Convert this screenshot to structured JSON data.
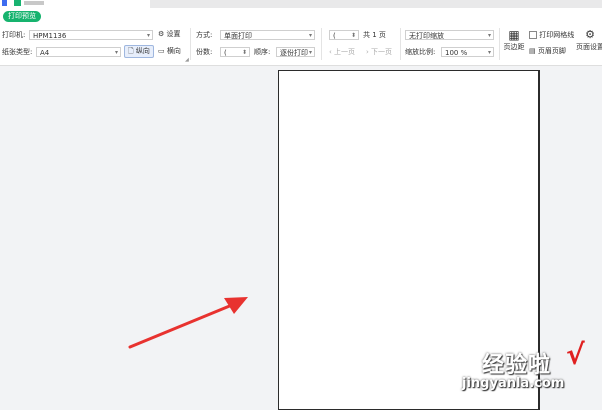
{
  "toolbar": {
    "preview_tab": "打印预览",
    "printer_label": "打印机:",
    "printer_value": "HPM1136",
    "settings_label": "设置",
    "paper_type_label": "纸张类型:",
    "paper_type_value": "A4",
    "portrait_label": "纵向",
    "landscape_label": "横向",
    "mode_label": "方式:",
    "mode_value": "单面打印",
    "copies_label": "份数:",
    "copies_value": "(",
    "order_label": "顺序:",
    "order_value": "逐份打印",
    "page_input_value": "(",
    "total_pages": "共 1 页",
    "prev_page": "上一页",
    "next_page": "下一页",
    "scale_mode_value": "无打印缩放",
    "scale_ratio_label": "缩放比例:",
    "scale_ratio_value": "100 %",
    "margins_label": "页边距",
    "gridlines_label": "打印网格线",
    "header_footer_label": "页眉页脚",
    "page_setup_label": "页面设置"
  },
  "watermark": {
    "title": "经验啦",
    "check": "√",
    "url": "jingyanla.com"
  },
  "colors": {
    "accent_green": "#16b36e",
    "arrow_red": "#e8322f"
  }
}
